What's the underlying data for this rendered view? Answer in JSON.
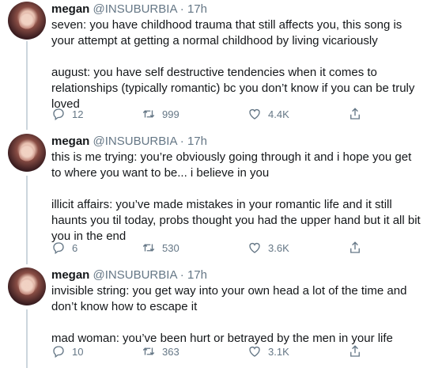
{
  "tweets": [
    {
      "name": "megan",
      "handle": "@INSUBURBIA",
      "separator": "·",
      "time": "17h",
      "paragraphs": [
        "seven: you have childhood trauma that still affects you, this song is your attempt at getting a normal childhood by living vicariously",
        "august: you have self destructive tendencies when it comes to relationships (typically romantic) bc you don’t know if you can be truly loved"
      ],
      "replies": "12",
      "retweets": "999",
      "likes": "4.4K"
    },
    {
      "name": "megan",
      "handle": "@INSUBURBIA",
      "separator": "·",
      "time": "17h",
      "paragraphs": [
        "this is me trying: you’re obviously going through it and i hope you get to where you want to be... i believe in you",
        "illicit affairs: you’ve made mistakes in your romantic life and it still haunts you til today, probs thought you had the upper hand but it all bit you in the end"
      ],
      "replies": "6",
      "retweets": "530",
      "likes": "3.6K"
    },
    {
      "name": "megan",
      "handle": "@INSUBURBIA",
      "separator": "·",
      "time": "17h",
      "paragraphs": [
        "invisible string: you get way into your own head a lot of the time and don’t know how to escape it",
        "mad woman: you’ve been hurt or betrayed by the men in your life"
      ],
      "replies": "10",
      "retweets": "363",
      "likes": "3.1K"
    }
  ],
  "icons": {
    "reply": "reply-icon",
    "retweet": "retweet-icon",
    "like": "heart-icon",
    "share": "share-icon"
  },
  "colors": {
    "text": "#14171a",
    "secondary": "#657786",
    "thread_line": "#ccd6dd"
  }
}
